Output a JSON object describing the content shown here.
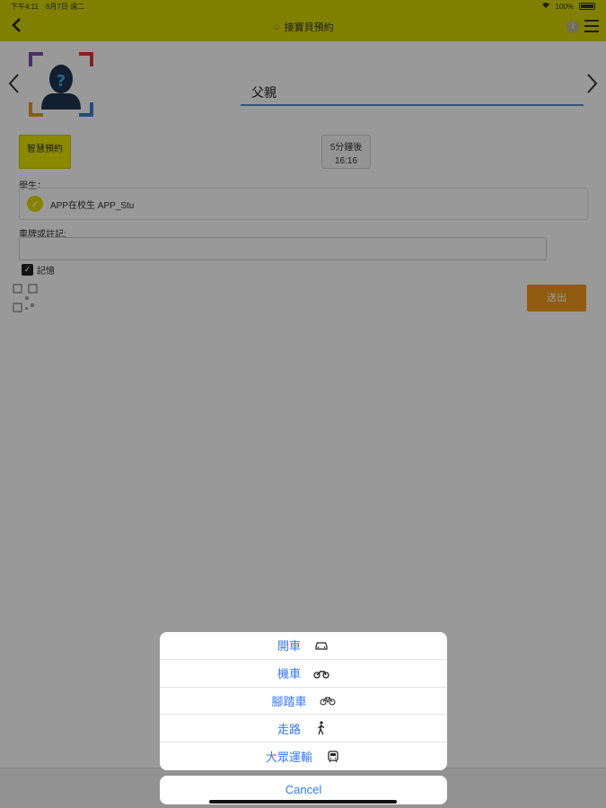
{
  "status_bar": {
    "time": "下午4:11",
    "date": "6月7日 週二",
    "battery": "100%"
  },
  "nav": {
    "title": "接寶貝預約"
  },
  "form": {
    "parent_name": "父親",
    "smart_button": "智慧預約",
    "eta_label": "5分鐘後",
    "eta_time": "16:16",
    "student_label": "學生：",
    "student_name": "APP在校生 APP_Stu",
    "plate_label": "車牌或註記:",
    "plate_value": "",
    "remember_label": "記憶",
    "submit_label": "送出"
  },
  "action_sheet": {
    "options": [
      {
        "label": "開車",
        "icon": "car-icon"
      },
      {
        "label": "機車",
        "icon": "motorcycle-icon"
      },
      {
        "label": "腳踏車",
        "icon": "bicycle-icon"
      },
      {
        "label": "走路",
        "icon": "walking-icon"
      },
      {
        "label": "大眾運輸",
        "icon": "bus-icon"
      }
    ],
    "cancel_label": "Cancel"
  },
  "colors": {
    "nav_bg": "#d8d500",
    "accent_blue": "#3478f6",
    "submit_bg": "#f29a1c",
    "smart_bg": "#e8e500"
  }
}
